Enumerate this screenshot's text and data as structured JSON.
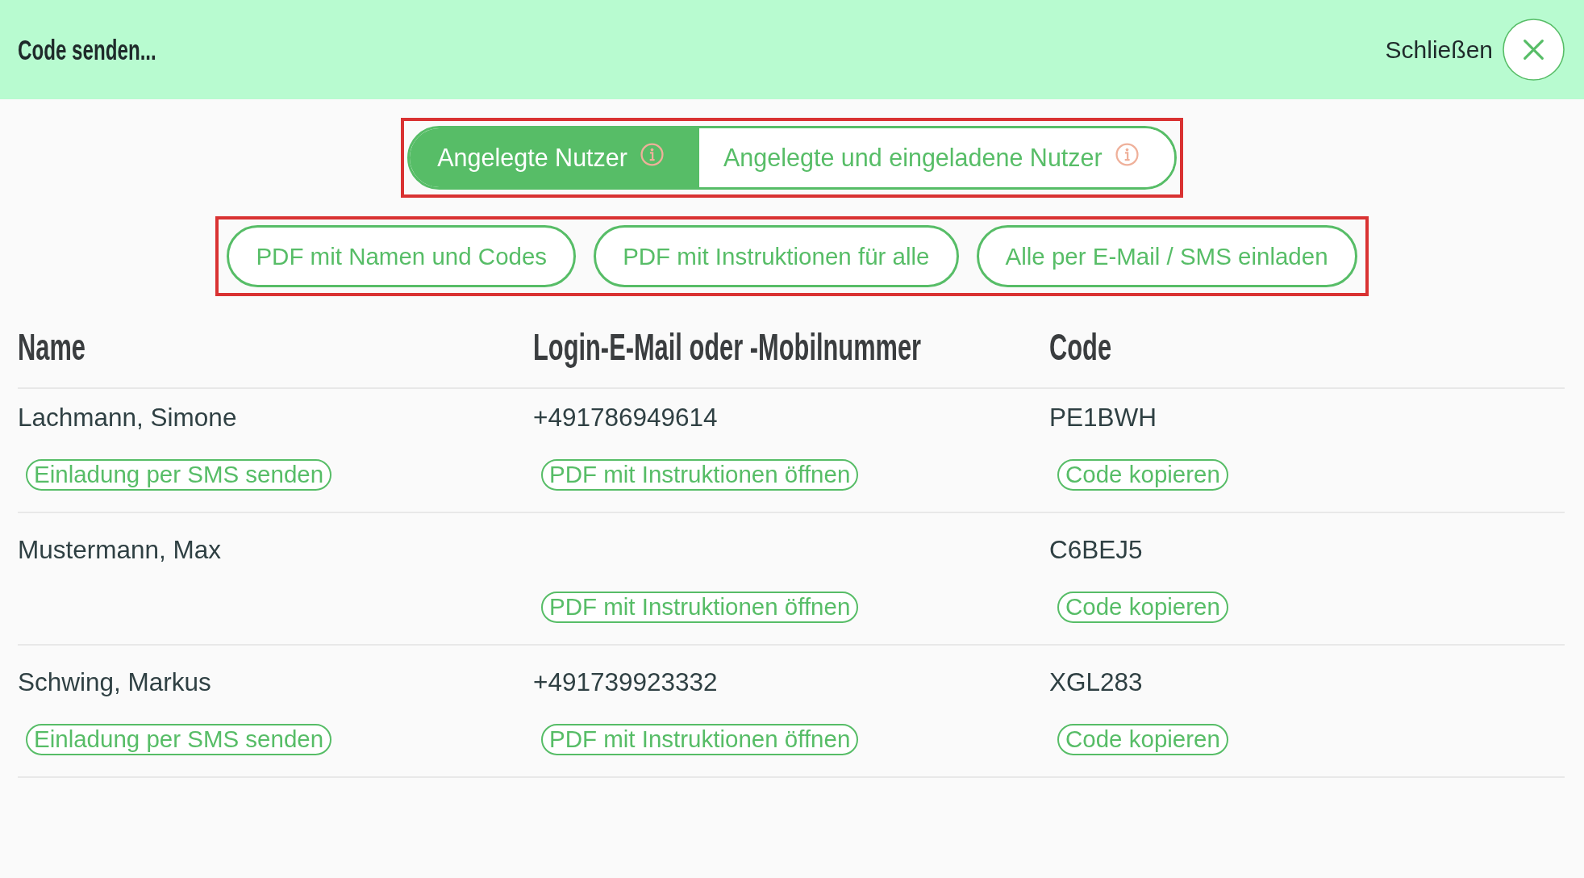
{
  "header": {
    "title": "Code senden...",
    "close_label": "Schließen"
  },
  "tab_bar": {
    "highlighted": true,
    "tabs": [
      {
        "label": "Angelegte Nutzer",
        "selected": true
      },
      {
        "label": "Angelegte und eingeladene Nutzer",
        "selected": false
      }
    ]
  },
  "action_bar": {
    "highlighted": true,
    "buttons": [
      "PDF mit Namen und Codes",
      "PDF mit Instruktionen für alle",
      "Alle per E-Mail / SMS einladen"
    ]
  },
  "table": {
    "columns": [
      "Name",
      "Login-E-Mail oder -Mobilnummer",
      "Code"
    ],
    "rows": [
      {
        "name": "Lachmann, Simone",
        "login": "+491786949614",
        "code": "PE1BWH",
        "invite_action": "Einladung per SMS senden",
        "pdf_action": "PDF mit Instruktionen öffnen",
        "copy_action": "Code kopieren"
      },
      {
        "name": "Mustermann, Max",
        "code": "C6BEJ5",
        "pdf_action": "PDF mit Instruktionen öffnen",
        "copy_action": "Code kopieren"
      },
      {
        "name": "Schwing, Markus",
        "login": "+491739923332",
        "code": "XGL283",
        "invite_action": "Einladung per SMS senden",
        "pdf_action": "PDF mit Instruktionen öffnen",
        "copy_action": "Code kopieren"
      }
    ]
  }
}
